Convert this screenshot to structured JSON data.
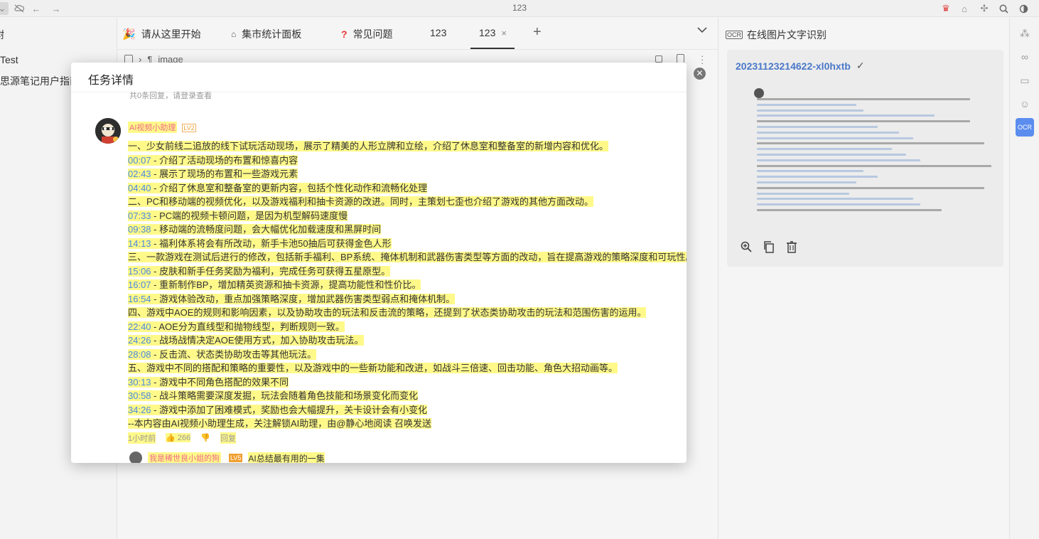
{
  "window": {
    "title": "123"
  },
  "sidebar": {
    "items": [
      {
        "label": "树"
      },
      {
        "label": "Test"
      },
      {
        "label": "思源笔记用户指南"
      }
    ]
  },
  "tabs": [
    {
      "icon": "party-icon",
      "label": "请从这里开始"
    },
    {
      "icon": "bank-icon",
      "label": "集市统计面板"
    },
    {
      "icon": "question-icon",
      "label": "常见问题"
    },
    {
      "icon": "",
      "label": "123"
    },
    {
      "icon": "",
      "label": "123",
      "active": true
    }
  ],
  "editor": {
    "breadcrumb": "image"
  },
  "right_panel": {
    "title": "在线图片文字识别",
    "ocr_item": {
      "name": "20231123214622-xl0hxtb"
    }
  },
  "modal": {
    "title": "任务详情",
    "peek_text": "共0条回复，请登录查看",
    "post": {
      "author": "AI视频小助理",
      "level": "LV2",
      "lines": [
        {
          "ts": "",
          "text": "一、少女前线二追放的线下试玩活动现场，展示了精美的人形立牌和立绘，介绍了休息室和整备室的新增内容和优化。"
        },
        {
          "ts": "00:07",
          "text": " - 介绍了活动现场的布置和惊喜内容"
        },
        {
          "ts": "02:43",
          "text": " - 展示了现场的布置和一些游戏元素"
        },
        {
          "ts": "04:40",
          "text": " - 介绍了休息室和整备室的更新内容，包括个性化动作和流畅化处理"
        },
        {
          "ts": "",
          "text": "二、PC和移动端的视频优化，以及游戏福利和抽卡资源的改进。同时，主策划七歪也介绍了游戏的其他方面改动。"
        },
        {
          "ts": "07:33",
          "text": " - PC端的视频卡顿问题，是因为机型解码速度慢"
        },
        {
          "ts": "09:38",
          "text": " - 移动端的流畅度问题，会大幅优化加载速度和黑屏时间"
        },
        {
          "ts": "14:13",
          "text": " - 福利体系将会有所改动，新手卡池50抽后可获得金色人形"
        },
        {
          "ts": "",
          "text": "三、一款游戏在测试后进行的修改，包括新手福利、BP系统、掩体机制和武器伤害类型等方面的改动，旨在提高游戏的策略深度和可玩性。"
        },
        {
          "ts": "15:06",
          "text": " - 皮肤和新手任务奖励为福利，完成任务可获得五星原型。"
        },
        {
          "ts": "16:07",
          "text": " - 重新制作BP，增加精英资源和抽卡资源，提高功能性和性价比。"
        },
        {
          "ts": "16:54",
          "text": " - 游戏体验改动，重点加强策略深度，增加武器伤害类型弱点和掩体机制。"
        },
        {
          "ts": "",
          "text": "四、游戏中AOE的规则和影响因素，以及协助攻击的玩法和反击流的策略，还提到了状态类协助攻击的玩法和范围伤害的运用。"
        },
        {
          "ts": "22:40",
          "text": " - AOE分为直线型和抛物线型，判断规则一致。"
        },
        {
          "ts": "24:26",
          "text": " - 战场战情决定AOE使用方式，加入协助攻击玩法。"
        },
        {
          "ts": "28:08",
          "text": " - 反击流、状态类协助攻击等其他玩法。"
        },
        {
          "ts": "",
          "text": "五、游戏中不同的搭配和策略的重要性，以及游戏中的一些新功能和改进，如战斗三倍速、回击功能、角色大招动画等。"
        },
        {
          "ts": "30:13",
          "text": " - 游戏中不同角色搭配的效果不同"
        },
        {
          "ts": "30:58",
          "text": " - 战斗策略需要深度发掘，玩法会随着角色技能和场景变化而变化"
        },
        {
          "ts": "34:26",
          "text": " - 游戏中添加了困难模式，奖励也会大幅提升，关卡设计会有小变化"
        },
        {
          "ts": "",
          "text": "--本内容由AI视频小助理生成，关注解锁AI助理，由@静心地阅读 召唤发送"
        }
      ],
      "meta": {
        "time": "1小时前",
        "likes": "266",
        "reply": "回复"
      }
    },
    "reply": {
      "author": "我是稀世良小姐的狗",
      "level": "LV5",
      "text": "AI总结最有用的一集"
    }
  }
}
